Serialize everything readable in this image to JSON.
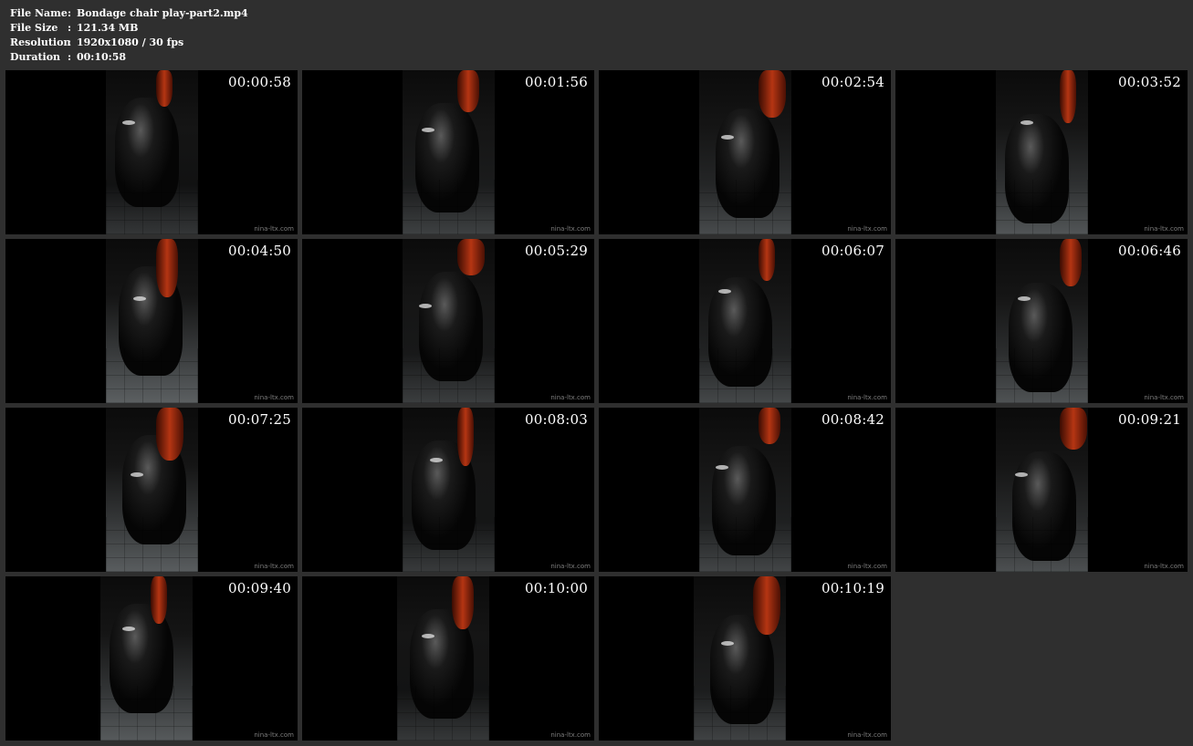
{
  "info": {
    "rows": [
      {
        "label": "File Name",
        "sep": ":",
        "value": "Bondage chair play-part2.mp4"
      },
      {
        "label": "File Size",
        "sep": ":",
        "value": "121.34 MB"
      },
      {
        "label": "Resolution",
        "sep": ":",
        "value": "1920x1080 / 30 fps"
      },
      {
        "label": "Duration",
        "sep": ":",
        "value": "00:10:58"
      }
    ]
  },
  "thumbnails": [
    {
      "timestamp": "00:00:58",
      "watermark": "nina-ltx.com"
    },
    {
      "timestamp": "00:01:56",
      "watermark": "nina-ltx.com"
    },
    {
      "timestamp": "00:02:54",
      "watermark": "nina-ltx.com"
    },
    {
      "timestamp": "00:03:52",
      "watermark": "nina-ltx.com"
    },
    {
      "timestamp": "00:04:50",
      "watermark": "nina-ltx.com"
    },
    {
      "timestamp": "00:05:29",
      "watermark": "nina-ltx.com"
    },
    {
      "timestamp": "00:06:07",
      "watermark": "nina-ltx.com"
    },
    {
      "timestamp": "00:06:46",
      "watermark": "nina-ltx.com"
    },
    {
      "timestamp": "00:07:25",
      "watermark": "nina-ltx.com"
    },
    {
      "timestamp": "00:08:03",
      "watermark": "nina-ltx.com"
    },
    {
      "timestamp": "00:08:42",
      "watermark": "nina-ltx.com"
    },
    {
      "timestamp": "00:09:21",
      "watermark": "nina-ltx.com"
    },
    {
      "timestamp": "00:09:40",
      "watermark": "nina-ltx.com"
    },
    {
      "timestamp": "00:10:00",
      "watermark": "nina-ltx.com"
    },
    {
      "timestamp": "00:10:19",
      "watermark": "nina-ltx.com"
    }
  ],
  "colors": {
    "background": "#2f2f2f",
    "text": "#ffffff",
    "watermark": "#7c7c7c",
    "frame_floor": "#8d9396",
    "frame_accent": "#b53513"
  }
}
